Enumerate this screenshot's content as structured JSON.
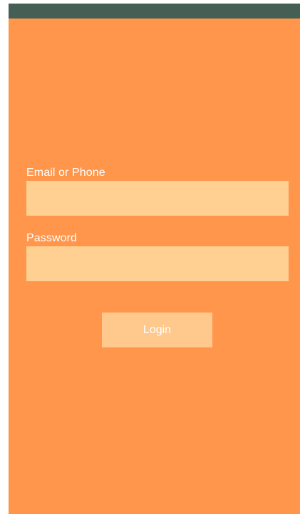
{
  "colors": {
    "status_bar": "#455f55",
    "background": "#ff964c",
    "field_fill": "#ffd092",
    "button_fill": "#ffc88c",
    "label_text": "#ffffff"
  },
  "form": {
    "email_label": "Email or Phone",
    "email_value": "",
    "email_placeholder": "",
    "password_label": "Password",
    "password_value": "",
    "password_placeholder": "",
    "login_label": "Login"
  }
}
